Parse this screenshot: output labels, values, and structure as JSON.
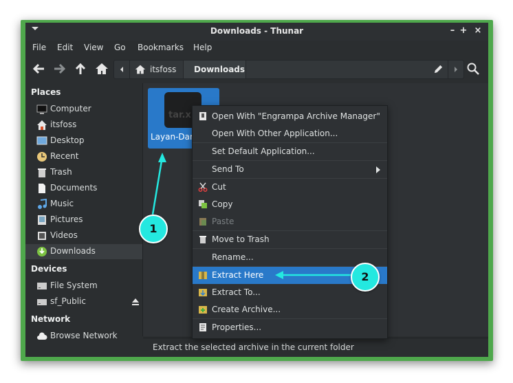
{
  "window": {
    "title": "Downloads - Thunar",
    "controls": {
      "minimize": "–",
      "maximize": "+",
      "close": "×"
    }
  },
  "menubar": [
    "File",
    "Edit",
    "View",
    "Go",
    "Bookmarks",
    "Help"
  ],
  "pathbar": {
    "home_label": "itsfoss",
    "current_label": "Downloads"
  },
  "sidebar": {
    "places_title": "Places",
    "places": [
      {
        "label": "Computer",
        "icon": "monitor-icon"
      },
      {
        "label": "itsfoss",
        "icon": "home-icon"
      },
      {
        "label": "Desktop",
        "icon": "desktop-icon"
      },
      {
        "label": "Recent",
        "icon": "clock-icon"
      },
      {
        "label": "Trash",
        "icon": "trash-icon"
      },
      {
        "label": "Documents",
        "icon": "document-icon"
      },
      {
        "label": "Music",
        "icon": "music-icon"
      },
      {
        "label": "Pictures",
        "icon": "pictures-icon"
      },
      {
        "label": "Videos",
        "icon": "videos-icon"
      },
      {
        "label": "Downloads",
        "icon": "download-icon"
      }
    ],
    "devices_title": "Devices",
    "devices": [
      {
        "label": "File System",
        "icon": "drive-icon"
      },
      {
        "label": "sf_Public",
        "icon": "drive-icon"
      }
    ],
    "network_title": "Network",
    "network": [
      {
        "label": "Browse Network",
        "icon": "cloud-icon"
      }
    ]
  },
  "file": {
    "name": "Layan-Dark",
    "icon_text": "tar.x"
  },
  "context_menu": {
    "items": [
      {
        "label": "Open With \"Engrampa Archive Manager\""
      },
      {
        "label": "Open With Other Application..."
      },
      {
        "label": "Set Default Application..."
      },
      {
        "label": "Send To"
      },
      {
        "label": "Cut"
      },
      {
        "label": "Copy"
      },
      {
        "label": "Paste"
      },
      {
        "label": "Move to Trash"
      },
      {
        "label": "Rename..."
      },
      {
        "label": "Extract Here"
      },
      {
        "label": "Extract To..."
      },
      {
        "label": "Create Archive..."
      },
      {
        "label": "Properties..."
      }
    ]
  },
  "statusbar": {
    "text": "Extract the selected archive in the current folder"
  },
  "annotations": {
    "step1": "1",
    "step2": "2"
  },
  "colors": {
    "accent": "#2979c9",
    "frame": "#4fa84c",
    "annotation": "#24e8e0"
  }
}
